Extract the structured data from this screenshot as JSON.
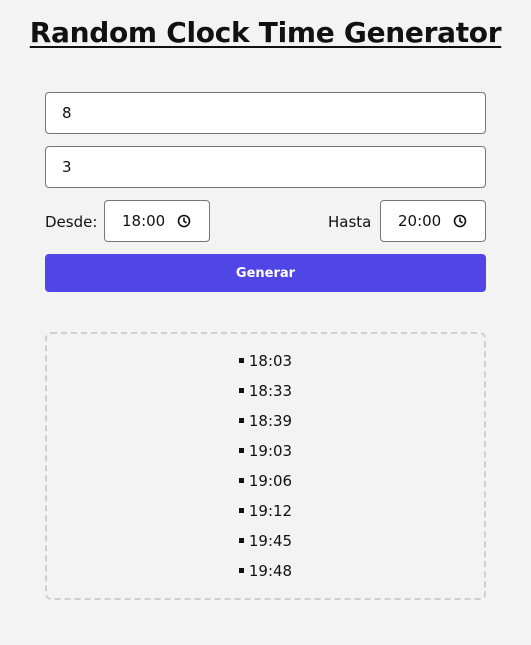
{
  "page": {
    "title": "Random Clock Time Generator"
  },
  "form": {
    "quantity_value": "8",
    "decimals_value": "3",
    "from_label": "Desde:",
    "from_time": "18:00",
    "to_label": "Hasta",
    "to_time": "20:00",
    "generate_label": "Generar"
  },
  "results": {
    "times": [
      "18:03",
      "18:33",
      "18:39",
      "19:03",
      "19:06",
      "19:12",
      "19:45",
      "19:48"
    ]
  },
  "icons": {
    "time_picker": "clock-icon",
    "list_marker": "square-bullet"
  },
  "colors": {
    "accent": "#4f46e5",
    "background": "#f3f3f3",
    "border": "#767676"
  }
}
